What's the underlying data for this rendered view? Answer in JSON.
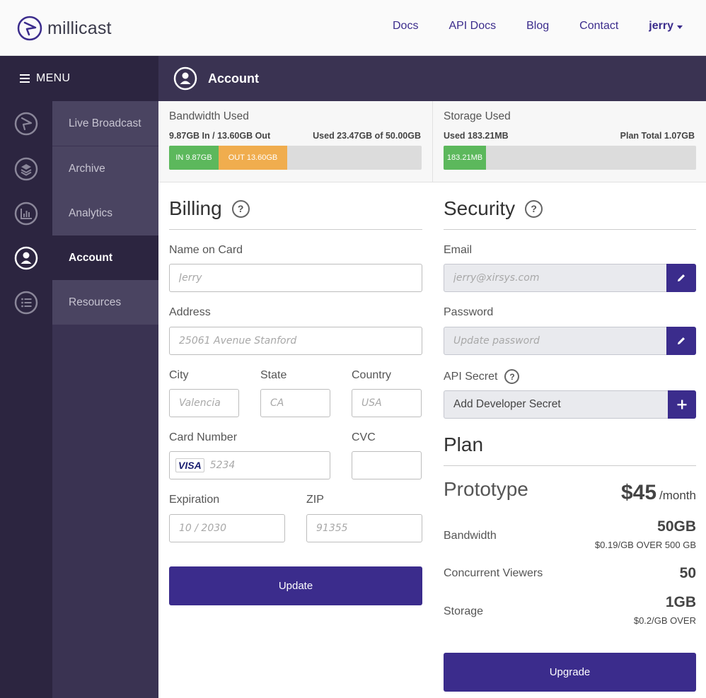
{
  "brand": {
    "name": "millicast"
  },
  "topnav": {
    "links": [
      "Docs",
      "API Docs",
      "Blog",
      "Contact"
    ],
    "user": "jerry"
  },
  "sidebar": {
    "menu_label": "MENU",
    "items": [
      {
        "label": "Live Broadcast",
        "icon": "play-arrow-icon"
      },
      {
        "label": "Archive",
        "icon": "layers-icon"
      },
      {
        "label": "Analytics",
        "icon": "bar-chart-icon"
      },
      {
        "label": "Account",
        "icon": "user-icon",
        "active": true
      },
      {
        "label": "Resources",
        "icon": "list-icon"
      }
    ]
  },
  "header": {
    "title": "Account"
  },
  "bandwidth": {
    "title": "Bandwidth Used",
    "summary": "9.87GB In / 13.60GB Out",
    "used": "Used 23.47GB of 50.00GB",
    "in_label": "IN 9.87GB",
    "out_label": "OUT 13.60GB",
    "in_fraction": 0.1974,
    "out_fraction": 0.272
  },
  "storage": {
    "title": "Storage Used",
    "used": "Used 183.21MB",
    "plan_total": "Plan Total 1.07GB",
    "bar_label": "183.21MB",
    "fraction": 0.168
  },
  "billing": {
    "title": "Billing",
    "name_label": "Name on Card",
    "name_placeholder": "Jerry",
    "address_label": "Address",
    "address_placeholder": "25061 Avenue Stanford",
    "city_label": "City",
    "city_placeholder": "Valencia",
    "state_label": "State",
    "state_placeholder": "CA",
    "country_label": "Country",
    "country_placeholder": "USA",
    "card_label": "Card Number",
    "card_brand": "VISA",
    "card_placeholder": "5234",
    "cvc_label": "CVC",
    "cvc_placeholder": "",
    "exp_label": "Expiration",
    "exp_placeholder": "10 / 2030",
    "zip_label": "ZIP",
    "zip_placeholder": "91355",
    "update_label": "Update"
  },
  "security": {
    "title": "Security",
    "email_label": "Email",
    "email_placeholder": "jerry@xirsys.com",
    "password_label": "Password",
    "password_placeholder": "Update password",
    "api_label": "API Secret",
    "api_button": "Add Developer Secret"
  },
  "plan": {
    "title": "Plan",
    "name": "Prototype",
    "price": "$45",
    "per": "/month",
    "bandwidth_label": "Bandwidth",
    "bandwidth_value": "50GB",
    "bandwidth_overage": "$0.19/GB OVER 500 GB",
    "viewers_label": "Concurrent Viewers",
    "viewers_value": "50",
    "storage_label": "Storage",
    "storage_value": "1GB",
    "storage_overage": "$0.2/GB OVER",
    "upgrade_label": "Upgrade"
  },
  "colors": {
    "brand": "#3b2c8c",
    "sidebar": "#3a3352",
    "in": "#5cb85c",
    "out": "#f0ad4e"
  }
}
